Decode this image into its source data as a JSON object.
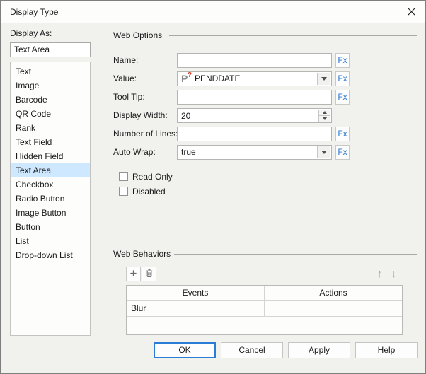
{
  "window": {
    "title": "Display Type"
  },
  "colors": {
    "dialog_bg": "#f1f1ee",
    "titlebar_bg": "#fdfdfc",
    "list_selection_bg": "#cde8ff",
    "fx_blue": "#2f7bd0",
    "parameter_icon_gray": "#8a8a8a",
    "parameter_icon_red": "#d8392b",
    "ok_default_border": "#2a7cd4"
  },
  "icons": {
    "close": "✕",
    "add": "+",
    "delete": "trash-can",
    "move_up": "↑",
    "move_down": "↓",
    "fx": "Fx",
    "parameter_letter": "P",
    "parameter_mark": "?",
    "dropdown": "▼",
    "spin_up": "▲",
    "spin_down": "▼"
  },
  "display_as": {
    "label": "Display As:",
    "selected_value": "Text Area",
    "items": [
      "Text",
      "Image",
      "Barcode",
      "QR Code",
      "Rank",
      "Text Field",
      "Hidden Field",
      "Text Area",
      "Checkbox",
      "Radio Button",
      "Image Button",
      "Button",
      "List",
      "Drop-down List"
    ]
  },
  "web_options": {
    "title": "Web Options",
    "name": {
      "label": "Name:",
      "value": ""
    },
    "value": {
      "label": "Value:",
      "value": "PENDDATE"
    },
    "tooltip": {
      "label": "Tool Tip:",
      "value": ""
    },
    "display_width": {
      "label": "Display Width:",
      "value": "20"
    },
    "number_of_lines": {
      "label": "Number of Lines:",
      "value": ""
    },
    "auto_wrap": {
      "label": "Auto Wrap:",
      "value": "true"
    },
    "read_only": {
      "label": "Read Only",
      "checked": false
    },
    "disabled": {
      "label": "Disabled",
      "checked": false
    }
  },
  "web_behaviors": {
    "title": "Web Behaviors",
    "columns": [
      "Events",
      "Actions"
    ],
    "rows": [
      {
        "events": "Blur",
        "actions": ""
      }
    ]
  },
  "footer": {
    "ok": "OK",
    "cancel": "Cancel",
    "apply": "Apply",
    "help": "Help"
  }
}
